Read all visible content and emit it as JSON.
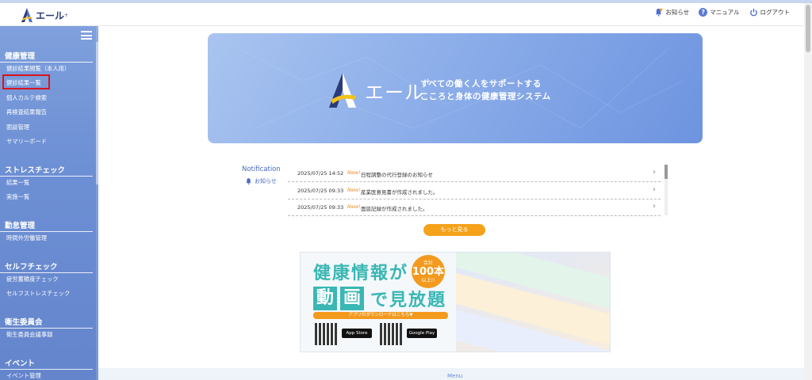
{
  "header": {
    "logo_text": "エール",
    "logo_sup": "+",
    "links": [
      {
        "label": "お知らせ",
        "icon": "bell-icon"
      },
      {
        "label": "マニュアル",
        "icon": "help-icon"
      },
      {
        "label": "ログアウト",
        "icon": "power-icon"
      }
    ],
    "help_glyph": "?"
  },
  "sidebar": {
    "sections": [
      {
        "title": "健康管理",
        "items": [
          "健診結果閲覧（本人用）",
          "健診結果一覧",
          "個人カルテ検索",
          "再検査結果報告",
          "面談管理",
          "サマリーボード"
        ]
      },
      {
        "title": "ストレスチェック",
        "items": [
          "結果一覧",
          "実施一覧"
        ]
      },
      {
        "title": "勤怠管理",
        "items": [
          "時間外労働管理"
        ]
      },
      {
        "title": "セルフチェック",
        "items": [
          "疲労蓄積度チェック",
          "セルフストレスチェック"
        ]
      },
      {
        "title": "衛生委員会",
        "items": [
          "衛生委員会議事録"
        ]
      },
      {
        "title": "イベント",
        "items": [
          "イベント管理"
        ]
      }
    ]
  },
  "banner": {
    "brand": "エール",
    "brand_sup": "+",
    "tagline1": "すべての働く人をサポートする",
    "tagline2": "こころと身体の健康管理システム"
  },
  "notifications": {
    "heading": "Notification",
    "sub": "お知らせ",
    "items": [
      {
        "date": "2025/07/25 14:52",
        "new": "New!",
        "text": "日程調整の代行登録のお知らせ"
      },
      {
        "date": "2025/07/25 09:33",
        "new": "New!",
        "text": "産業医意見書が作成されました。"
      },
      {
        "date": "2025/07/25 09:33",
        "new": "New!",
        "text": "面談記録が作成されました。"
      }
    ],
    "more_button": "もっと見る"
  },
  "promo": {
    "line1": "健康情報が",
    "box1": "動",
    "box2": "画",
    "line2_rest": "で見放題",
    "badge_top": "合計",
    "badge_num": "100本",
    "badge_bottom": "以上!!",
    "download": "アプリのダウンロードはこちら▼",
    "app_store": "App Store",
    "google_play": "Google Play"
  },
  "footer": {
    "label": "Menu"
  }
}
